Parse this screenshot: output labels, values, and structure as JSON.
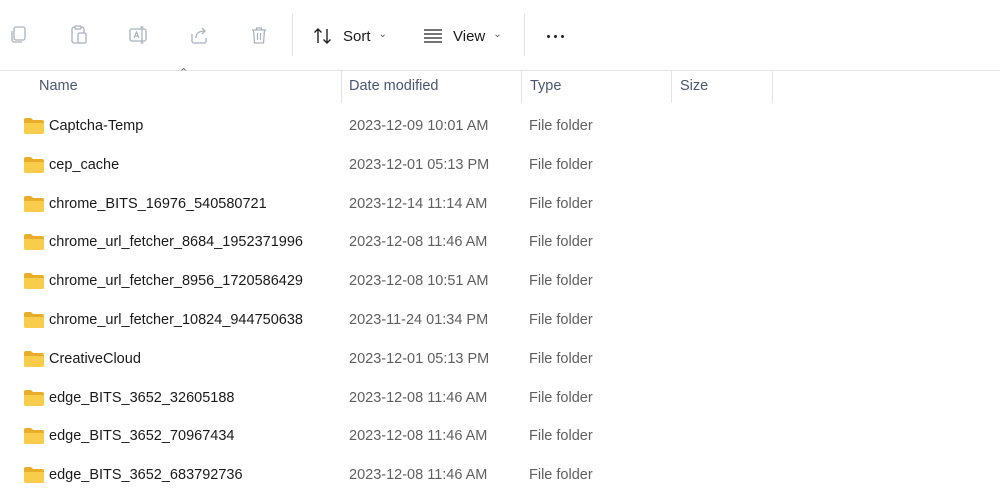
{
  "toolbar": {
    "sort_label": "Sort",
    "view_label": "View",
    "icons": [
      "copy-icon",
      "paste-icon",
      "rename-icon",
      "share-icon",
      "delete-icon"
    ]
  },
  "columns": {
    "name": "Name",
    "date": "Date modified",
    "type": "Type",
    "size": "Size"
  },
  "rows": [
    {
      "name": "Captcha-Temp",
      "date": "2023-12-09 10:01 AM",
      "type": "File folder",
      "size": ""
    },
    {
      "name": "cep_cache",
      "date": "2023-12-01 05:13 PM",
      "type": "File folder",
      "size": ""
    },
    {
      "name": "chrome_BITS_16976_540580721",
      "date": "2023-12-14 11:14 AM",
      "type": "File folder",
      "size": ""
    },
    {
      "name": "chrome_url_fetcher_8684_1952371996",
      "date": "2023-12-08 11:46 AM",
      "type": "File folder",
      "size": ""
    },
    {
      "name": "chrome_url_fetcher_8956_1720586429",
      "date": "2023-12-08 10:51 AM",
      "type": "File folder",
      "size": ""
    },
    {
      "name": "chrome_url_fetcher_10824_944750638",
      "date": "2023-11-24 01:34 PM",
      "type": "File folder",
      "size": ""
    },
    {
      "name": "CreativeCloud",
      "date": "2023-12-01 05:13 PM",
      "type": "File folder",
      "size": ""
    },
    {
      "name": "edge_BITS_3652_32605188",
      "date": "2023-12-08 11:46 AM",
      "type": "File folder",
      "size": ""
    },
    {
      "name": "edge_BITS_3652_70967434",
      "date": "2023-12-08 11:46 AM",
      "type": "File folder",
      "size": ""
    },
    {
      "name": "edge_BITS_3652_683792736",
      "date": "2023-12-08 11:46 AM",
      "type": "File folder",
      "size": ""
    }
  ],
  "colors": {
    "folder": "#F8C73E",
    "folder_dark": "#E5A823",
    "disabled_icon": "#9aa4b3"
  }
}
